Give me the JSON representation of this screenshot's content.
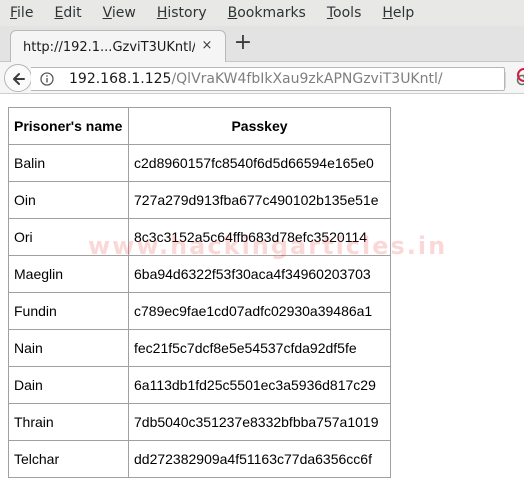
{
  "menubar": {
    "items": [
      {
        "label": "File"
      },
      {
        "label": "Edit"
      },
      {
        "label": "View"
      },
      {
        "label": "History"
      },
      {
        "label": "Bookmarks"
      },
      {
        "label": "Tools"
      },
      {
        "label": "Help"
      }
    ]
  },
  "tab": {
    "title": "http://192.1...GzviT3UKntl/",
    "close_icon": "×",
    "new_tab_icon": "+"
  },
  "navbar": {
    "url_host": "192.168.1.125",
    "url_path": "/QlVraKW4fbIkXau9zkAPNGzviT3UKntl/"
  },
  "table": {
    "headers": [
      "Prisoner's name",
      "Passkey"
    ],
    "rows": [
      {
        "name": "Balin",
        "passkey": "c2d8960157fc8540f6d5d66594e165e0"
      },
      {
        "name": "Oin",
        "passkey": "727a279d913fba677c490102b135e51e"
      },
      {
        "name": "Ori",
        "passkey": "8c3c3152a5c64ffb683d78efc3520114"
      },
      {
        "name": "Maeglin",
        "passkey": "6ba94d6322f53f30aca4f34960203703"
      },
      {
        "name": "Fundin",
        "passkey": "c789ec9fae1cd07adfc02930a39486a1"
      },
      {
        "name": "Nain",
        "passkey": "fec21f5c7dcf8e5e54537cfda92df5fe"
      },
      {
        "name": "Dain",
        "passkey": "6a113db1fd25c5501ec3a5936d817c29"
      },
      {
        "name": "Thrain",
        "passkey": "7db5040c351237e8332bfbba757a1019"
      },
      {
        "name": "Telchar",
        "passkey": "dd272382909a4f51163c77da6356cc6f"
      }
    ]
  },
  "watermark": {
    "text": "www.hackingarticles.in"
  },
  "colors": {
    "menubar_bg": "#e8e8e7",
    "url_path": "#7f7f7f",
    "watermark": "#eb2828"
  }
}
